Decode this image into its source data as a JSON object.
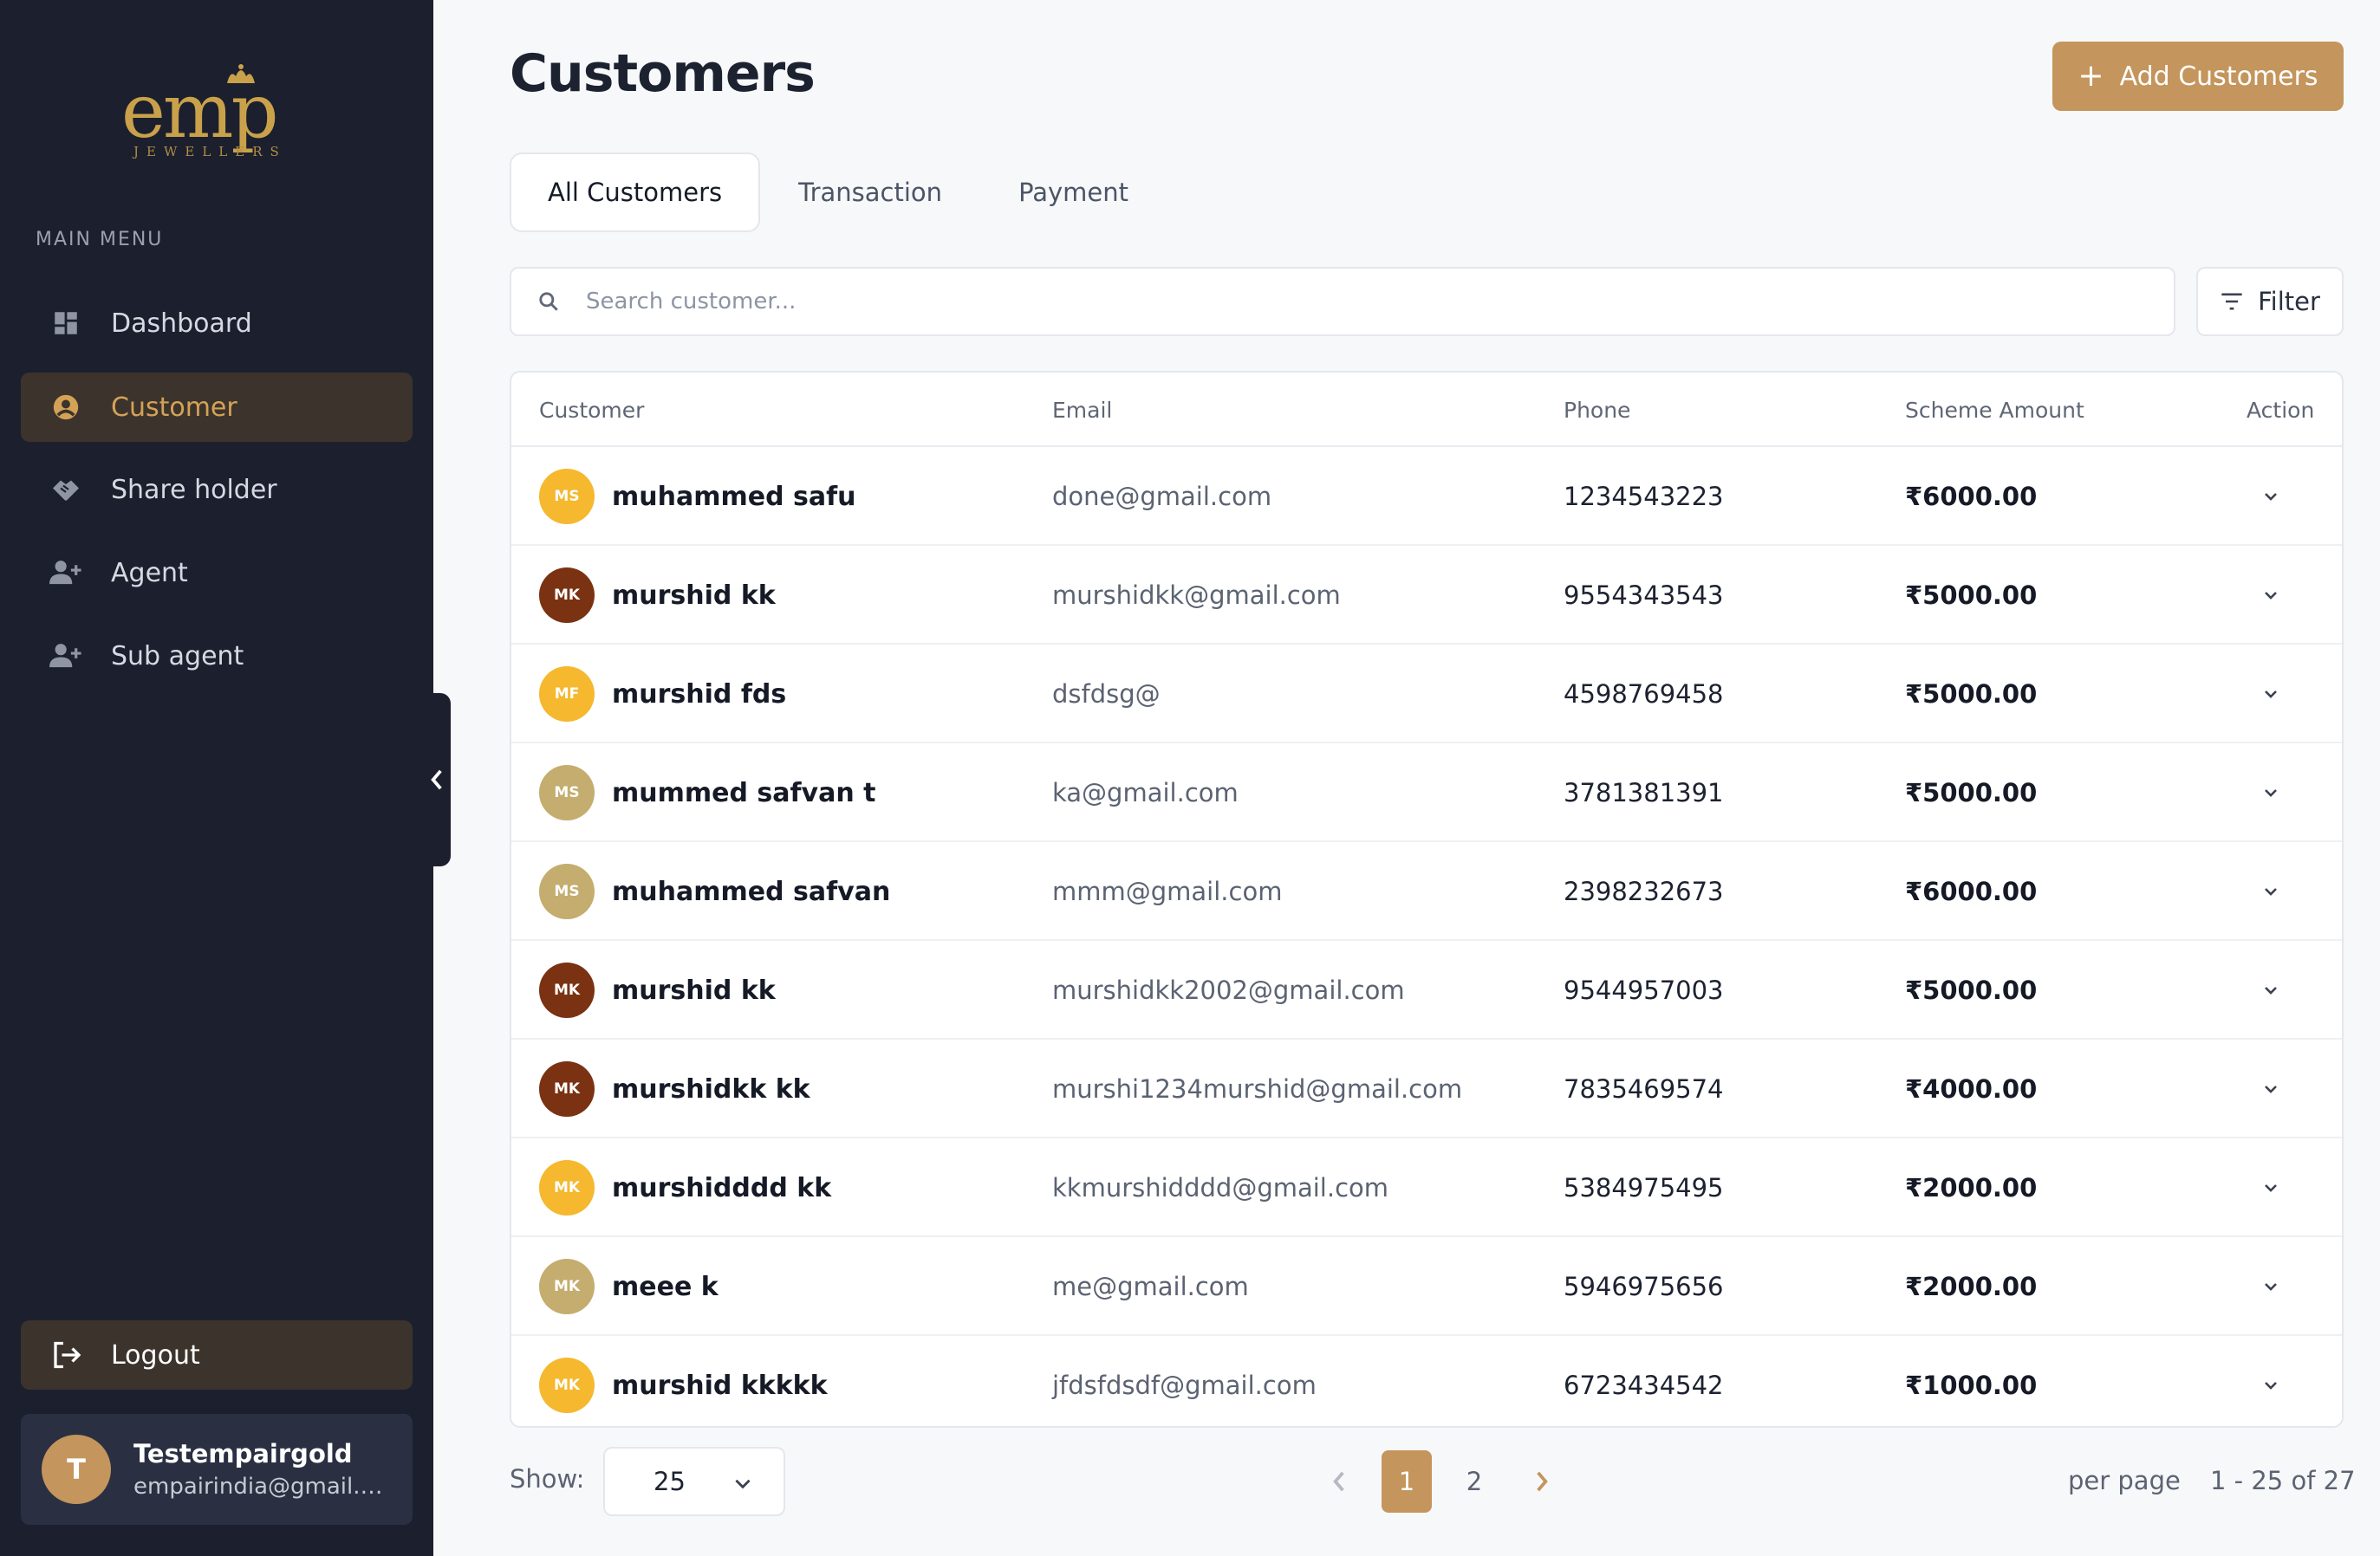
{
  "brand": {
    "logo_text": "emp",
    "logo_subtext": "JEWELLERS"
  },
  "sidebar": {
    "heading": "MAIN MENU",
    "items": [
      {
        "label": "Dashboard",
        "icon": "dashboard-icon",
        "active": false
      },
      {
        "label": "Customer",
        "icon": "user-circle-icon",
        "active": true
      },
      {
        "label": "Share holder",
        "icon": "handshake-icon",
        "active": false
      },
      {
        "label": "Agent",
        "icon": "person-add-icon",
        "active": false
      },
      {
        "label": "Sub agent",
        "icon": "person-add-icon",
        "active": false
      }
    ],
    "logout_label": "Logout",
    "user": {
      "initial": "T",
      "name": "Testempairgold",
      "email": "empairindia@gmail.com"
    }
  },
  "header": {
    "title": "Customers",
    "add_button_label": "Add Customers"
  },
  "tabs": [
    {
      "label": "All Customers",
      "active": true
    },
    {
      "label": "Transaction",
      "active": false
    },
    {
      "label": "Payment",
      "active": false
    }
  ],
  "search": {
    "placeholder": "Search customer...",
    "value": ""
  },
  "filter_label": "Filter",
  "table": {
    "columns": [
      "Customer",
      "Email",
      "Phone",
      "Scheme Amount",
      "Action"
    ],
    "rows": [
      {
        "initials": "MS",
        "avatar_color": "#f5b82e",
        "name": "muhammed safu",
        "email": "done@gmail.com",
        "phone": "1234543223",
        "amount": "₹6000.00"
      },
      {
        "initials": "MK",
        "avatar_color": "#7a3212",
        "name": "murshid kk",
        "email": "murshidkk@gmail.com",
        "phone": "9554343543",
        "amount": "₹5000.00"
      },
      {
        "initials": "MF",
        "avatar_color": "#f5b82e",
        "name": "murshid fds",
        "email": "dsfdsg@",
        "phone": "4598769458",
        "amount": "₹5000.00"
      },
      {
        "initials": "MS",
        "avatar_color": "#c4ad6e",
        "name": "mummed safvan t",
        "email": "ka@gmail.com",
        "phone": "3781381391",
        "amount": "₹5000.00"
      },
      {
        "initials": "MS",
        "avatar_color": "#c4ad6e",
        "name": "muhammed  safvan",
        "email": "mmm@gmail.com",
        "phone": "2398232673",
        "amount": "₹6000.00"
      },
      {
        "initials": "MK",
        "avatar_color": "#7a3212",
        "name": "murshid kk",
        "email": "murshidkk2002@gmail.com",
        "phone": "9544957003",
        "amount": "₹5000.00"
      },
      {
        "initials": "MK",
        "avatar_color": "#7a3212",
        "name": "murshidkk kk",
        "email": "murshi1234murshid@gmail.com",
        "phone": "7835469574",
        "amount": "₹4000.00"
      },
      {
        "initials": "MK",
        "avatar_color": "#f5b82e",
        "name": "murshidddd kk",
        "email": "kkmurshidddd@gmail.com",
        "phone": "5384975495",
        "amount": "₹2000.00"
      },
      {
        "initials": "MK",
        "avatar_color": "#c4ad6e",
        "name": "meee k",
        "email": "me@gmail.com",
        "phone": "5946975656",
        "amount": "₹2000.00"
      },
      {
        "initials": "MK",
        "avatar_color": "#f5b82e",
        "name": "murshid kkkkk",
        "email": "jfdsfdsdf@gmail.com",
        "phone": "6723434542",
        "amount": "₹1000.00"
      }
    ]
  },
  "footer": {
    "show_label": "Show:",
    "page_size": "25",
    "pages": [
      "1",
      "2"
    ],
    "current_page": "1",
    "per_page_label": "per page",
    "range_text": "1 - 25 of 27"
  },
  "colors": {
    "accent": "#c4955c",
    "sidebar_bg": "#1c1f2e",
    "active_nav_bg": "#3c342c",
    "active_nav_text": "#d4a257"
  }
}
